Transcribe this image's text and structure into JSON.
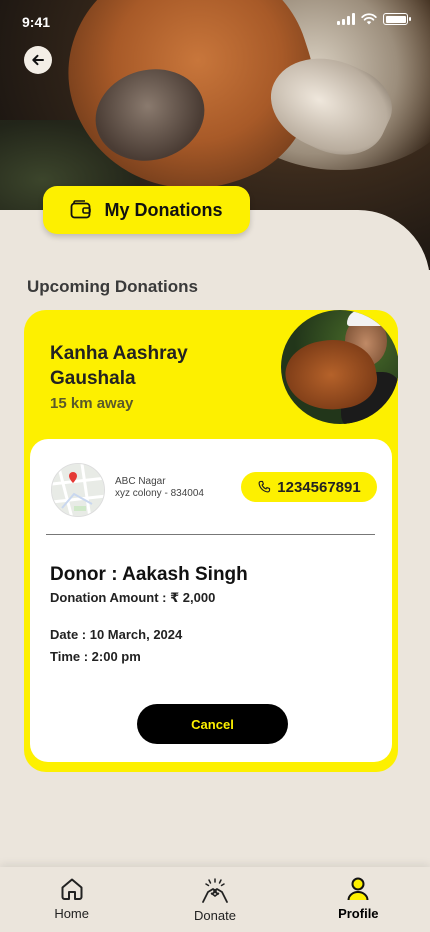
{
  "status_bar": {
    "time": "9:41"
  },
  "header": {
    "title": "My Donations"
  },
  "section": {
    "title": "Upcoming Donations"
  },
  "donation": {
    "gaushala_name": "Kanha Aashray Gaushala",
    "distance": "15 km away",
    "address_line1": "ABC Nagar",
    "address_line2": "xyz colony - 834004",
    "phone": "1234567891",
    "donor": "Donor : Aakash Singh",
    "amount": "Donation Amount : ₹ 2,000",
    "date": "Date : 10 March, 2024",
    "time": "Time : 2:00 pm",
    "cancel_label": "Cancel"
  },
  "nav": {
    "items": [
      {
        "label": "Home",
        "icon": "home-icon",
        "active": false
      },
      {
        "label": "Donate",
        "icon": "donate-icon",
        "active": false
      },
      {
        "label": "Profile",
        "icon": "profile-icon",
        "active": true
      }
    ]
  },
  "colors": {
    "accent": "#fdf000",
    "background": "#ebe5dc",
    "button": "#000000"
  }
}
